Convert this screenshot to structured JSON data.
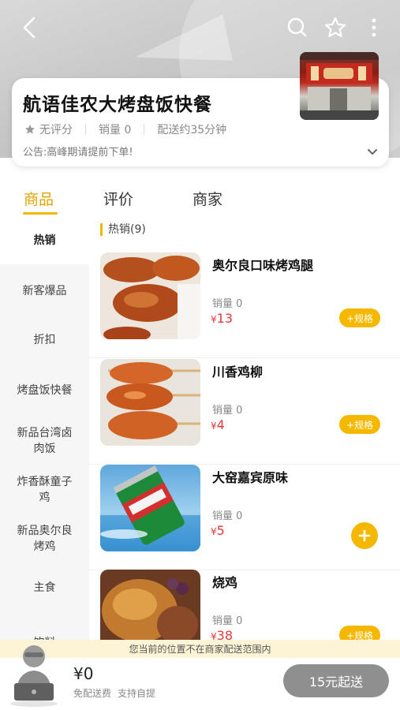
{
  "header": {
    "store_name": "航语佳农大烤盘饭快餐",
    "rating": "无评分",
    "sales": "销量 0",
    "delivery_time": "配送约35分钟",
    "notice": "公告:高峰期请提前下单!"
  },
  "icons": {
    "back": "chevron-left-icon",
    "search": "search-icon",
    "favorite": "star-icon",
    "more": "more-vertical-icon"
  },
  "tabs": [
    {
      "label": "商品",
      "active": true
    },
    {
      "label": "评价",
      "active": false
    },
    {
      "label": "商家",
      "active": false
    }
  ],
  "sidebar": {
    "items": [
      {
        "label": "热销",
        "active": true
      },
      {
        "label": "新客爆品"
      },
      {
        "label": "折扣"
      },
      {
        "label": "烤盘饭快餐"
      },
      {
        "label": "新品台湾卤肉饭"
      },
      {
        "label": "炸香酥童子鸡"
      },
      {
        "label": "新品奥尔良烤鸡"
      },
      {
        "label": "主食"
      },
      {
        "label": "饮料"
      }
    ]
  },
  "section": {
    "title": "热销(9)"
  },
  "products": [
    {
      "name": "奥尔良口味烤鸡腿",
      "sales": "销量 0",
      "currency": "¥",
      "price": "13",
      "action": "+规格"
    },
    {
      "name": "川香鸡柳",
      "sales": "销量 0",
      "currency": "¥",
      "price": "4",
      "action": "+规格"
    },
    {
      "name": "大窑嘉宾原味",
      "sales": "销量 0",
      "currency": "¥",
      "price": "5",
      "action": "+"
    },
    {
      "name": "烧鸡",
      "sales": "销量 0",
      "currency": "¥",
      "price": "38",
      "action": "+规格"
    }
  ],
  "notice_bar": "您当前的位置不在商家配送范围内",
  "cart": {
    "total": "¥0",
    "free_delivery": "免配送费",
    "self_pickup": "支持自提",
    "checkout": "15元起送"
  },
  "colors": {
    "accent": "#f5b800",
    "price": "#e4393c",
    "disabled": "#8f8f8f"
  }
}
